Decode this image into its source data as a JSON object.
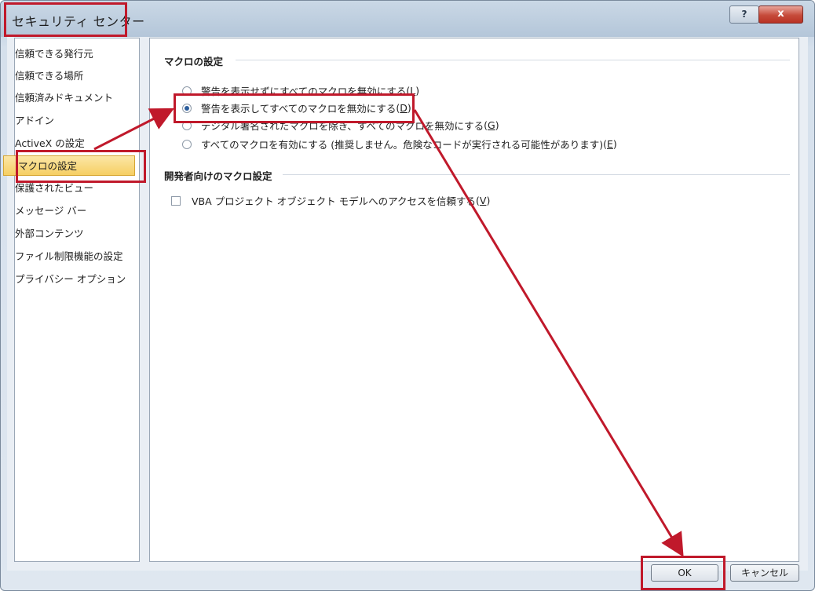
{
  "window": {
    "title": "セキュリティ センター",
    "help_label": "?",
    "close_label": "x"
  },
  "sidebar": {
    "items": [
      {
        "label": "信頼できる発行元"
      },
      {
        "label": "信頼できる場所"
      },
      {
        "label": "信頼済みドキュメント"
      },
      {
        "label": "アドイン"
      },
      {
        "label": "ActiveX の設定"
      },
      {
        "label": "マクロの設定",
        "selected": true
      },
      {
        "label": "保護されたビュー"
      },
      {
        "label": "メッセージ バー"
      },
      {
        "label": "外部コンテンツ"
      },
      {
        "label": "ファイル制限機能の設定"
      },
      {
        "label": "プライバシー オプション"
      }
    ]
  },
  "macro_settings": {
    "title": "マクロの設定",
    "options": [
      {
        "label": "警告を表示せずにすべてのマクロを無効にする",
        "accel": "L",
        "selected": false
      },
      {
        "label": "警告を表示してすべてのマクロを無効にする",
        "accel": "D",
        "selected": true
      },
      {
        "label": "デジタル署名されたマクロを除き、すべてのマクロを無効にする",
        "accel": "G",
        "selected": false
      },
      {
        "label": "すべてのマクロを有効にする (推奨しません。危険なコードが実行される可能性があります)",
        "accel": "E",
        "selected": false
      }
    ]
  },
  "developer_settings": {
    "title": "開発者向けのマクロ設定",
    "vba_access": {
      "label": "VBA プロジェクト オブジェクト モデルへのアクセスを信頼する",
      "accel": "V",
      "checked": false
    }
  },
  "buttons": {
    "ok": "OK",
    "cancel": "キャンセル"
  },
  "colors": {
    "highlight": "#c0192b",
    "selected_item": "#f6cf63",
    "radio_dot": "#2b5d9c"
  }
}
